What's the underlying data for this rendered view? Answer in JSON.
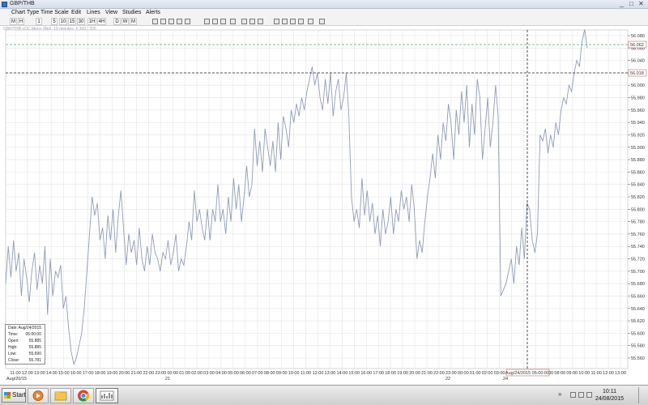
{
  "window": {
    "title": "GBP/THB",
    "min_glyph": "_",
    "max_glyph": "□",
    "close_glyph": "✕"
  },
  "menu": [
    "Chart Type",
    "Time Scale",
    "Edit",
    "Lines",
    "View",
    "Studies",
    "Alerts"
  ],
  "toolbar": {
    "intervals": [
      "M",
      "H",
      "1",
      "5",
      "10",
      "15",
      "30",
      "1H",
      "4H",
      "D",
      "W",
      "M"
    ]
  },
  "info_line": "GBP/THB <DC Men> (Bid), 10 minutes, # 300 / 300",
  "ohlc": {
    "rows": [
      {
        "k": "Date:",
        "v": "Aug/24/2015"
      },
      {
        "k": "Time:",
        "v": "05:00:00"
      },
      {
        "k": "Open:",
        "v": "55.885"
      },
      {
        "k": "High:",
        "v": "55.885"
      },
      {
        "k": "Low:",
        "v": "55.690"
      },
      {
        "k": "Close:",
        "v": "55.781"
      }
    ]
  },
  "crosshair": {
    "time_label": "Aug/24/2015 05:00:00",
    "price_label": "56.018"
  },
  "bid_label": "56.062",
  "date_labels": [
    {
      "at": "11:00",
      "text": "Aug/20/15"
    },
    {
      "at": "21:00b",
      "text": "21"
    },
    {
      "at": "00:00d",
      "text": "22"
    },
    {
      "at": "04:00f",
      "text": "24"
    }
  ],
  "taskbar": {
    "start_label": "Start",
    "clock_time": "10:11",
    "clock_date": "24/08/2015",
    "tray_chevron": "»"
  },
  "chart_data": {
    "type": "line",
    "series": [
      {
        "values": [
          55.68,
          55.74,
          55.69,
          55.75,
          55.7,
          55.73,
          55.66,
          55.72,
          55.69,
          55.65,
          55.7,
          55.73,
          55.67,
          55.71,
          55.68,
          55.74,
          55.63,
          55.72,
          55.66,
          55.7,
          55.69,
          55.71,
          55.64,
          55.66,
          55.61,
          55.57,
          55.55,
          55.56,
          55.58,
          55.6,
          55.64,
          55.7,
          55.76,
          55.82,
          55.79,
          55.81,
          55.75,
          55.77,
          55.72,
          55.79,
          55.75,
          55.8,
          55.73,
          55.79,
          55.83,
          55.77,
          55.71,
          55.76,
          55.73,
          55.75,
          55.71,
          55.77,
          55.72,
          55.7,
          55.74,
          55.71,
          55.76,
          55.73,
          55.72,
          55.7,
          55.73,
          55.72,
          55.75,
          55.71,
          55.73,
          55.76,
          55.7,
          55.72,
          55.71,
          55.74,
          55.78,
          55.75,
          55.83,
          55.78,
          55.8,
          55.77,
          55.75,
          55.8,
          55.75,
          55.8,
          55.78,
          55.84,
          55.78,
          55.8,
          55.76,
          55.82,
          55.78,
          55.85,
          55.8,
          55.84,
          55.78,
          55.82,
          55.87,
          55.82,
          55.84,
          55.93,
          55.87,
          55.91,
          55.86,
          55.93,
          55.9,
          55.87,
          55.91,
          55.86,
          55.94,
          55.88,
          55.95,
          55.93,
          55.9,
          55.96,
          55.94,
          55.97,
          55.95,
          55.98,
          55.96,
          55.99,
          56.01,
          56.03,
          56.0,
          56.02,
          55.98,
          55.96,
          56.01,
          55.97,
          56.02,
          55.95,
          55.99,
          56.01,
          55.96,
          55.98,
          56.02,
          55.95,
          55.82,
          55.78,
          55.8,
          55.77,
          55.85,
          55.79,
          55.83,
          55.78,
          55.81,
          55.76,
          55.79,
          55.74,
          55.8,
          55.76,
          55.78,
          55.82,
          55.76,
          55.8,
          55.78,
          55.83,
          55.8,
          55.82,
          55.78,
          55.84,
          55.8,
          55.72,
          55.75,
          55.73,
          55.78,
          55.82,
          55.85,
          55.89,
          55.85,
          55.92,
          55.88,
          55.94,
          55.91,
          55.97,
          55.94,
          55.88,
          55.96,
          55.92,
          55.99,
          55.94,
          56.0,
          55.9,
          55.97,
          55.92,
          56.01,
          55.98,
          55.88,
          55.93,
          55.98,
          55.9,
          55.94,
          56.0,
          55.95,
          55.66,
          55.67,
          55.68,
          55.7,
          55.72,
          55.68,
          55.74,
          55.71,
          55.77,
          55.72,
          55.81,
          55.8,
          55.75,
          55.73,
          55.76,
          55.92,
          55.91,
          55.93,
          55.89,
          55.92,
          55.9,
          55.94,
          55.92,
          55.96,
          55.98,
          55.97,
          56.0,
          55.99,
          56.02,
          56.04,
          56.03,
          56.07,
          56.09,
          56.06
        ]
      }
    ],
    "yaxis": {
      "ticks": [
        "56.080",
        "56.060",
        "56.040",
        "56.020",
        "56.000",
        "55.980",
        "55.960",
        "55.940",
        "55.920",
        "55.900",
        "55.880",
        "55.860",
        "55.840",
        "55.820",
        "55.800",
        "55.780",
        "55.760",
        "55.740",
        "55.720",
        "55.700",
        "55.680",
        "55.660",
        "55.640",
        "55.620",
        "55.600",
        "55.580",
        "55.560"
      ],
      "ylim": [
        55.548,
        56.092
      ]
    },
    "xaxis": {
      "ticks": [
        "11:00",
        "12:00",
        "13:00",
        "14:00",
        "15:00",
        "16:00",
        "17:00",
        "18:00",
        "19:00",
        "20:00",
        "21:00",
        "22:00",
        "23:00",
        "00:00",
        "01:00",
        "02:00",
        "03:00",
        "04:00",
        "05:00",
        "06:00",
        "07:00",
        "08:00",
        "09:00",
        "10:00",
        "11:00",
        "12:00",
        "13:00",
        "14:00",
        "15:00",
        "16:00",
        "17:00",
        "18:00",
        "19:00",
        "20:00",
        "21:00",
        "22:00",
        "23:00",
        "00:00",
        "01:00",
        "02:00",
        "03:00",
        "04:00",
        "05:00",
        "06:00",
        "07:00",
        "08:00",
        "09:00",
        "10:00",
        "11:00",
        "12:00",
        "13:00"
      ]
    },
    "grid": true,
    "line_color": "#8f9cb6",
    "crosshair_color": "#222222",
    "bid_line_color": "#4caf6e"
  }
}
